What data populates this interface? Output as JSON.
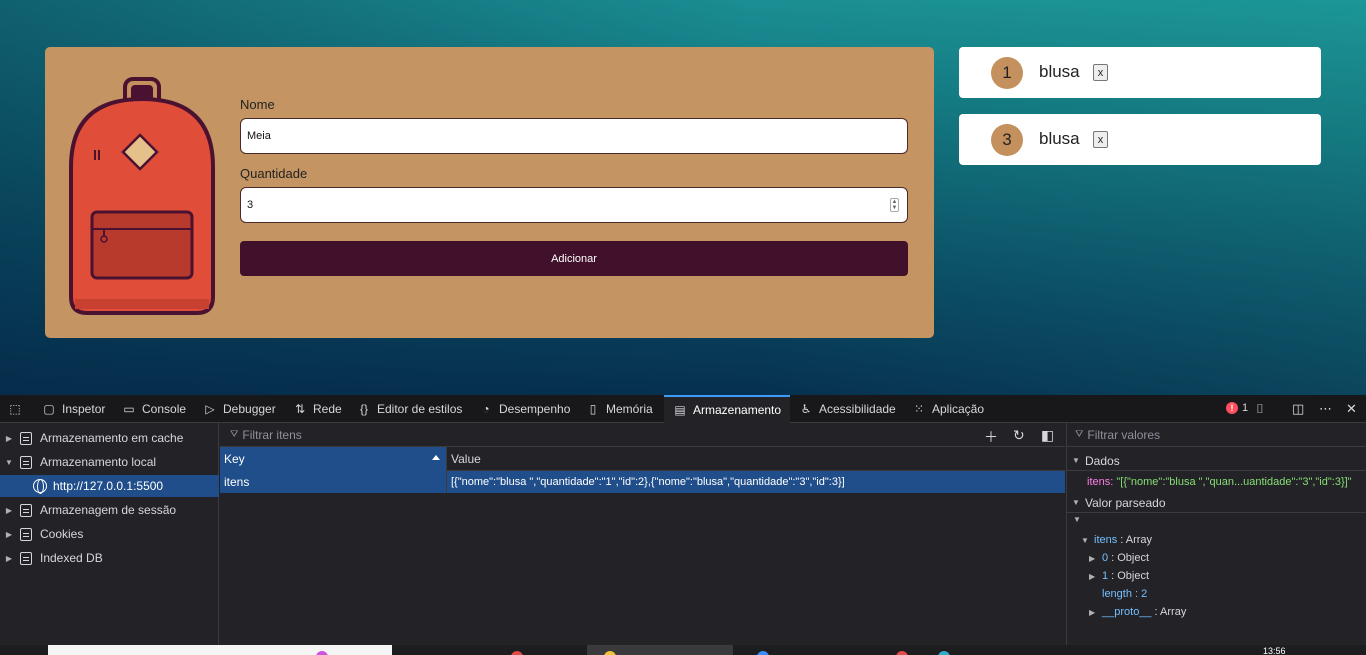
{
  "app": {
    "form": {
      "nome_label": "Nome",
      "nome_value": "Meia",
      "quantidade_label": "Quantidade",
      "quantidade_value": "3",
      "add_button": "Adicionar"
    },
    "list": [
      {
        "qty": "1",
        "name": "blusa",
        "remove": "x"
      },
      {
        "qty": "3",
        "name": "blusa",
        "remove": "x"
      }
    ]
  },
  "devtools": {
    "tabs": [
      "Inspetor",
      "Console",
      "Debugger",
      "Rede",
      "Editor de estilos",
      "Desempenho",
      "Memória",
      "Armazenamento",
      "Acessibilidade",
      "Aplicação"
    ],
    "active_tab": "Armazenamento",
    "error_count": "1",
    "storage_tree": [
      "Armazenamento em cache",
      "Armazenamento local",
      "http://127.0.0.1:5500",
      "Armazenagem de sessão",
      "Cookies",
      "Indexed DB"
    ],
    "filter_items_placeholder": "Filtrar itens",
    "table": {
      "col_key": "Key",
      "col_value": "Value",
      "row_key": "itens",
      "row_value": "[{\"nome\":\"blusa \",\"quantidade\":\"1\",\"id\":2},{\"nome\":\"blusa\",\"quantidade\":\"3\",\"id\":3}]"
    },
    "sidebar": {
      "filter_placeholder": "Filtrar valores",
      "dados_label": "Dados",
      "dados_key": "itens:",
      "dados_value": "\"[{\"nome\":\"blusa \",\"quan...uantidade\":\"3\",\"id\":3}]\"",
      "parsed_label": "Valor parseado",
      "tree": {
        "root_key": "itens",
        "root_type": ": Array",
        "item0_key": "0",
        "item0_type": ": Object",
        "item1_key": "1",
        "item1_type": ": Object",
        "length_key": "length",
        "length_value": ": 2",
        "proto_key": "__proto__",
        "proto_type": ": Array"
      }
    }
  },
  "taskbar": {
    "clock": "13:56"
  }
}
